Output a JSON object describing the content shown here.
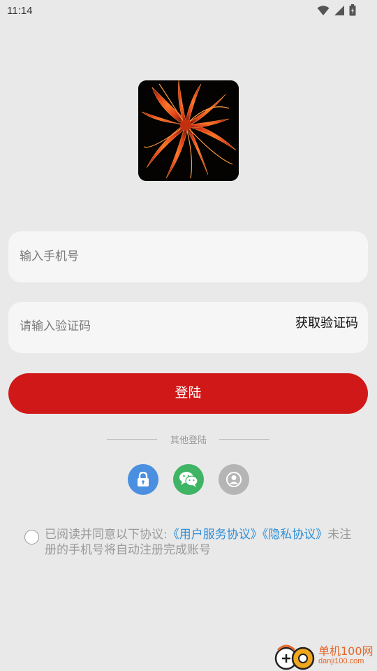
{
  "status_bar": {
    "time": "11:14",
    "icons": [
      "wifi-icon",
      "signal-icon",
      "battery-icon"
    ]
  },
  "logo": {
    "icon": "red-spider-lily-logo"
  },
  "phone_field": {
    "placeholder": "输入手机号"
  },
  "code_field": {
    "placeholder": "请输入验证码",
    "get_code_label": "获取验证码"
  },
  "login_button": {
    "label": "登陆"
  },
  "other_login": {
    "label": "其他登陆",
    "options": [
      {
        "icon": "lock-icon",
        "color": "#4a8fe0"
      },
      {
        "icon": "wechat-icon",
        "color": "#3fb464"
      },
      {
        "icon": "user-icon",
        "color": "#b5b5b5"
      }
    ]
  },
  "agreement": {
    "prefix": "已阅读并同意以下协议:",
    "user_agreement": "《用户服务协议》",
    "privacy_policy": "《隐私协议》",
    "suffix": "未注册的手机号将自动注册完成账号"
  },
  "watermark": {
    "title": "单机100网",
    "subtitle": "danji100.com"
  },
  "colors": {
    "background": "#e9e9e9",
    "primary": "#d11818",
    "link": "#2f8fd8"
  }
}
